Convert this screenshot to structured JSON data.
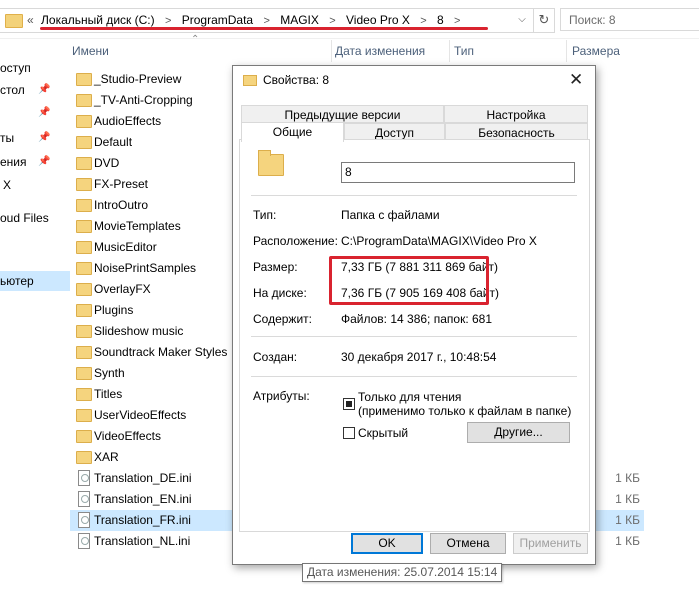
{
  "address": {
    "crumb_prefix": "«",
    "crumbs": [
      "Локальный диск (C:)",
      "ProgramData",
      "MAGIX",
      "Video Pro X",
      "8"
    ],
    "dropdown_icon": "chevron-down-icon",
    "refresh_icon": "refresh-icon",
    "search_placeholder": "Поиск: 8"
  },
  "nav": {
    "items": [
      {
        "label": "оступ",
        "pinned": true
      },
      {
        "label": "стол",
        "pinned": true
      },
      {
        "label": "ты",
        "pinned": true
      },
      {
        "label": "ения",
        "pinned": true
      },
      {
        "label": "X",
        "pinned": false
      },
      {
        "label": "oud Files",
        "pinned": false
      },
      {
        "label": "ьютер",
        "pinned": false,
        "selected": true
      }
    ]
  },
  "columns": {
    "name": "Имени",
    "date": "Дата изменения",
    "type": "Тип",
    "size": "Размера"
  },
  "files": [
    {
      "name": "_Studio-Preview",
      "kind": "folder",
      "size": ""
    },
    {
      "name": "_TV-Anti-Cropping",
      "kind": "folder",
      "size": ""
    },
    {
      "name": "AudioEffects",
      "kind": "folder",
      "size": ""
    },
    {
      "name": "Default",
      "kind": "folder",
      "size": ""
    },
    {
      "name": "DVD",
      "kind": "folder",
      "size": ""
    },
    {
      "name": "FX-Preset",
      "kind": "folder",
      "size": ""
    },
    {
      "name": "IntroOutro",
      "kind": "folder",
      "size": ""
    },
    {
      "name": "MovieTemplates",
      "kind": "folder",
      "size": ""
    },
    {
      "name": "MusicEditor",
      "kind": "folder",
      "size": ""
    },
    {
      "name": "NoisePrintSamples",
      "kind": "folder",
      "size": ""
    },
    {
      "name": "OverlayFX",
      "kind": "folder",
      "size": ""
    },
    {
      "name": "Plugins",
      "kind": "folder",
      "size": ""
    },
    {
      "name": "Slideshow music",
      "kind": "folder",
      "size": ""
    },
    {
      "name": "Soundtrack Maker Styles",
      "kind": "folder",
      "size": ""
    },
    {
      "name": "Synth",
      "kind": "folder",
      "size": ""
    },
    {
      "name": "Titles",
      "kind": "folder",
      "size": ""
    },
    {
      "name": "UserVideoEffects",
      "kind": "folder",
      "size": ""
    },
    {
      "name": "VideoEffects",
      "kind": "folder",
      "size": ""
    },
    {
      "name": "XAR",
      "kind": "folder",
      "size": ""
    },
    {
      "name": "Translation_DE.ini",
      "kind": "file",
      "size": "1 КБ"
    },
    {
      "name": "Translation_EN.ini",
      "kind": "file",
      "size": "1 КБ"
    },
    {
      "name": "Translation_FR.ini",
      "kind": "file",
      "size": "1 КБ",
      "selected": true
    },
    {
      "name": "Translation_NL.ini",
      "kind": "file",
      "size": "1 КБ"
    }
  ],
  "dialog": {
    "title": "Свойства: 8",
    "close_icon": "close-icon",
    "tabs_top": [
      "Предыдущие версии",
      "Настройка"
    ],
    "tabs_bottom": [
      "Общие",
      "Доступ",
      "Безопасность"
    ],
    "active_tab": "Общие",
    "folder_name": "8",
    "props": {
      "type_label": "Тип:",
      "type_value": "Папка с файлами",
      "location_label": "Расположение:",
      "location_value": "C:\\ProgramData\\MAGIX\\Video Pro X",
      "size_label": "Размер:",
      "size_value": "7,33 ГБ (7 881 311 869 байт)",
      "disk_label": "На диске:",
      "disk_value": "7,36 ГБ (7 905 169 408 байт)",
      "contains_label": "Содержит:",
      "contains_value": "Файлов: 14 386; папок: 681",
      "created_label": "Создан:",
      "created_value": "30 декабря 2017 г., 10:48:54",
      "attributes_label": "Атрибуты:",
      "readonly_label": "Только для чтения",
      "readonly_note": "(применимо только к файлам в папке)",
      "readonly_checked": "indeterminate",
      "hidden_label": "Скрытый",
      "hidden_checked": false,
      "other_button": "Другие..."
    },
    "buttons": {
      "ok": "OK",
      "cancel": "Отмена",
      "apply": "Применить"
    }
  },
  "tooltip": "Дата изменения: 25.07.2014 15:14",
  "colors": {
    "highlight": "#d9232f",
    "selection": "#cce8ff",
    "accent": "#0078d7"
  }
}
